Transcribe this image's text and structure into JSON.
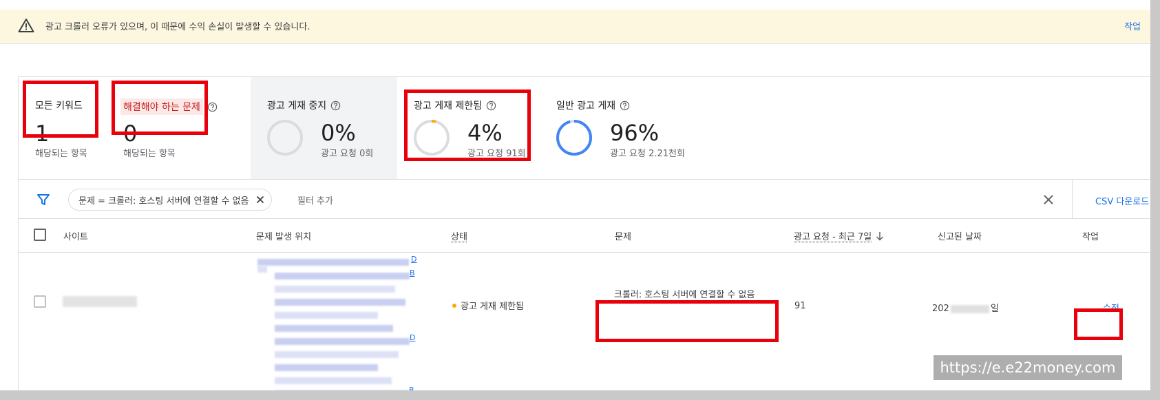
{
  "banner": {
    "message": "광고 크롤러 오류가 있으며, 이 때문에 수익 손실이 발생할 수 있습니다.",
    "action_label": "작업"
  },
  "stats": {
    "all_keywords": {
      "title": "모든 키워드",
      "value": "1",
      "sub": "해당되는 항목"
    },
    "issues": {
      "title": "해결해야 하는 문제",
      "value": "0",
      "sub": "해당되는 항목"
    },
    "paused": {
      "title": "광고 게재 중지",
      "value": "0%",
      "sub": "광고 요청 0회",
      "fraction": 0.0
    },
    "limited": {
      "title": "광고 게재 제한됨",
      "value": "4%",
      "sub": "광고 요청 91회",
      "fraction": 0.04
    },
    "normal": {
      "title": "일반 광고 게재",
      "value": "96%",
      "sub": "광고 요청 2.21천회",
      "fraction": 0.96
    }
  },
  "filter": {
    "chip_label": "문제 = 크롤러: 호스팅 서버에 연결할 수 없음",
    "add_label": "필터 추가",
    "csv_label": "CSV 다운로드"
  },
  "table": {
    "headers": {
      "site": "사이트",
      "location": "문제 발생 위치",
      "status": "상태",
      "problem": "문제",
      "requests": "광고 요청 - 최근 7일",
      "reported": "신고된 날짜",
      "action": "작업"
    },
    "row": {
      "status": "광고 게재 제한됨",
      "problem": "크롤러: 호스팅 서버에 연결할 수 없음",
      "requests": "91",
      "reported_prefix": "202",
      "reported_suffix": "일",
      "action_label": "수정",
      "link_end_d": "D",
      "link_end_b": "B"
    }
  },
  "colors": {
    "accent": "#1a73e8",
    "warning": "#f9ab00",
    "error_text": "#c5221f",
    "highlight": "#e8000b",
    "donut_track": "#dadce0"
  },
  "watermark": "https://e.e22money.com"
}
